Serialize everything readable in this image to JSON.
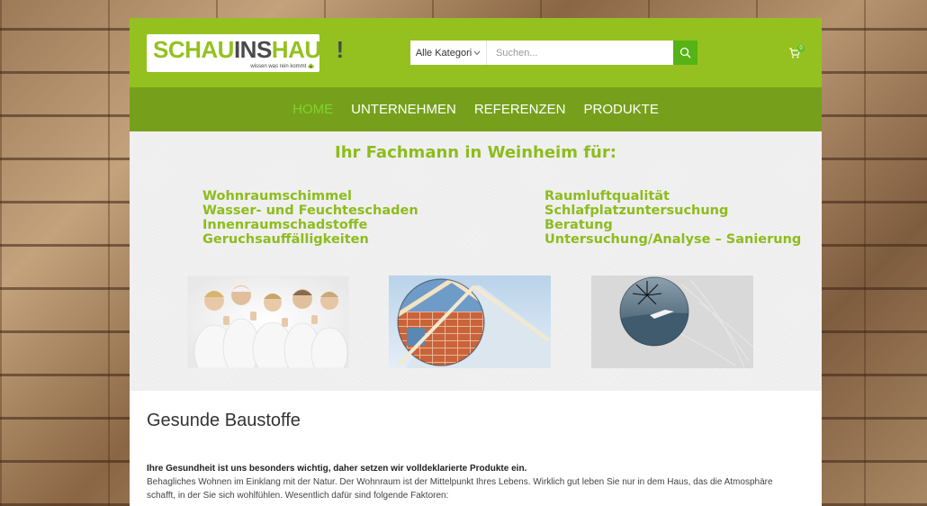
{
  "header": {
    "logo": {
      "part1": "SCHAU",
      "part2": "INS",
      "part3": "HAUS",
      "part4": "!",
      "tagline": "wissen was rein kommt"
    },
    "search": {
      "category": "Alle Kategori",
      "placeholder": "Suchen..."
    },
    "cart_count": "0"
  },
  "nav": {
    "items": [
      "HOME",
      "UNTERNEHMEN",
      "REFERENZEN",
      "PRODUKTE"
    ],
    "active": "HOME"
  },
  "hero": {
    "title": "Ihr Fachmann in Weinheim für:",
    "left_items": [
      "Wohnraumschimmel",
      "Wasser- und Feuchteschaden",
      "Innenraumschadstoffe",
      "Geruchsauffälligkeiten"
    ],
    "right_items": [
      "Raumluftqualität",
      "Schlafplatzuntersuchung",
      "Beratung",
      "Untersuchung/Analyse – Sanierung"
    ]
  },
  "content": {
    "title": "Gesunde Baustoffe",
    "lead": "Ihre Gesundheit ist uns besonders wichtig, daher setzen wir volldeklarierte Produkte ein.",
    "body": "Behagliches Wohnen im Einklang mit der Natur. Der Wohnraum ist der Mittelpunkt Ihres Lebens. Wirklich gut leben Sie nur in dem Haus, das die Atmosphäre schafft, in der Sie sich wohlfühlen. Wesentlich dafür sind folgende Faktoren:"
  },
  "colors": {
    "brand_green": "#94c11f",
    "nav_green": "#76a01b",
    "text_green": "#8dbc1d",
    "search_button": "#55b316"
  }
}
